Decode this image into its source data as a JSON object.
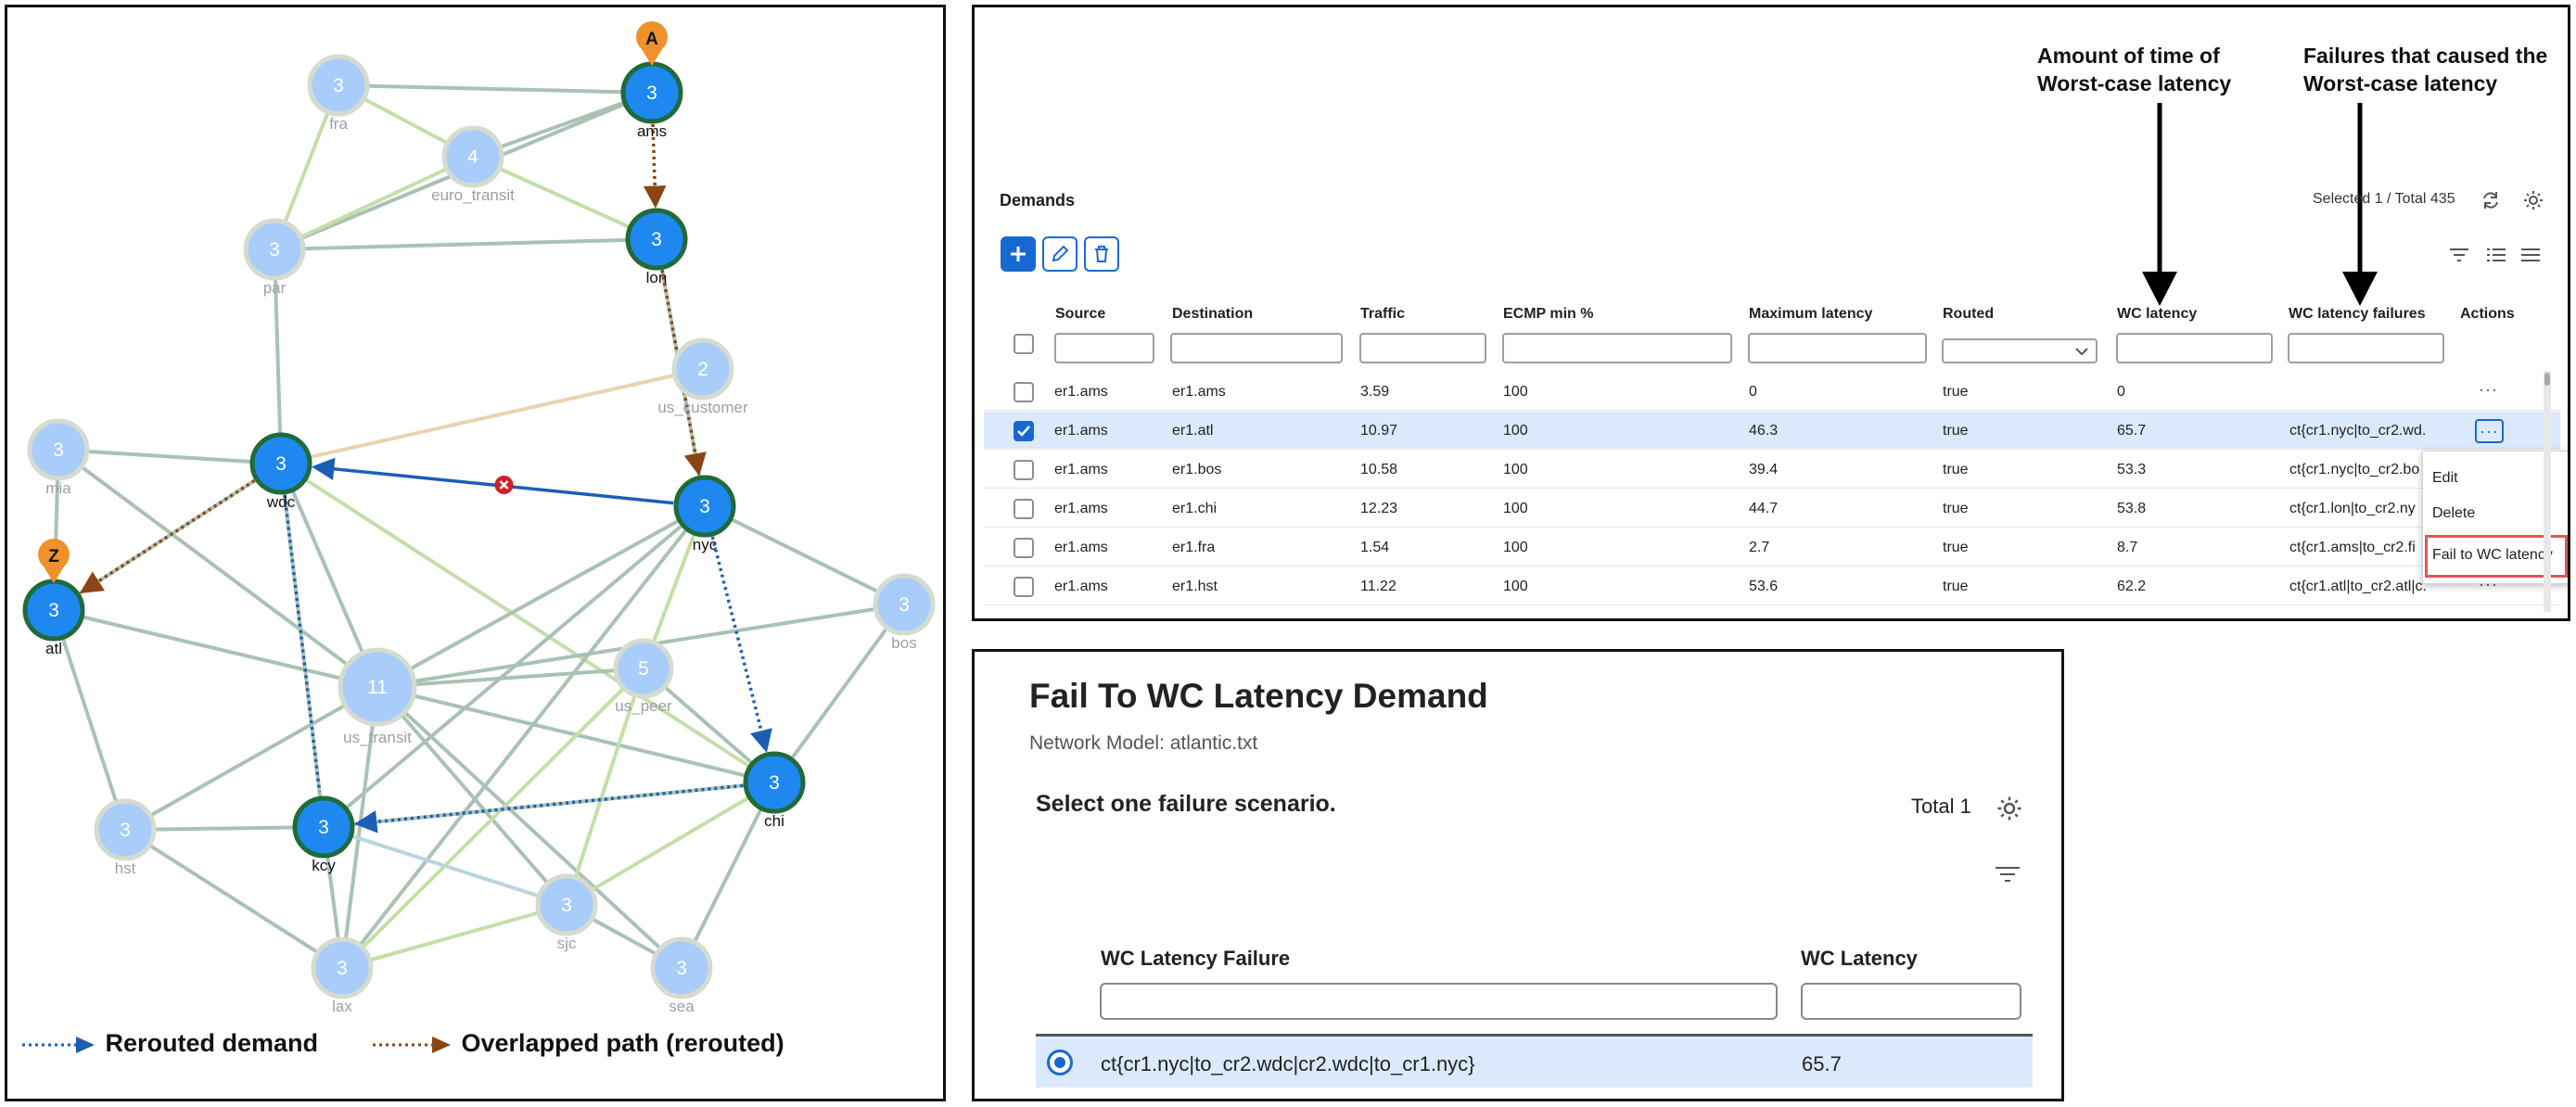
{
  "topology": {
    "nodes": [
      {
        "id": "fra",
        "label": "fra",
        "count": "3",
        "active": false
      },
      {
        "id": "ams",
        "label": "ams",
        "count": "3",
        "active": true,
        "marker": "A"
      },
      {
        "id": "euro_transit",
        "label": "euro_transit",
        "count": "4",
        "active": false
      },
      {
        "id": "par",
        "label": "par",
        "count": "3",
        "active": false
      },
      {
        "id": "lon",
        "label": "lon",
        "count": "3",
        "active": true
      },
      {
        "id": "us_customer",
        "label": "us_customer",
        "count": "2",
        "active": false
      },
      {
        "id": "mia",
        "label": "mia",
        "count": "3",
        "active": false
      },
      {
        "id": "wdc",
        "label": "wdc",
        "count": "3",
        "active": true
      },
      {
        "id": "nyc",
        "label": "nyc",
        "count": "3",
        "active": true
      },
      {
        "id": "atl",
        "label": "atl",
        "count": "3",
        "active": true,
        "marker": "Z"
      },
      {
        "id": "bos",
        "label": "bos",
        "count": "3",
        "active": false
      },
      {
        "id": "us_transit",
        "label": "us_transit",
        "count": "11",
        "active": false
      },
      {
        "id": "us_peer",
        "label": "us_peer",
        "count": "5",
        "active": false
      },
      {
        "id": "chi",
        "label": "chi",
        "count": "3",
        "active": true
      },
      {
        "id": "hst",
        "label": "hst",
        "count": "3",
        "active": false
      },
      {
        "id": "kcy",
        "label": "kcy",
        "count": "3",
        "active": true
      },
      {
        "id": "sjc",
        "label": "sjc",
        "count": "3",
        "active": false
      },
      {
        "id": "lax",
        "label": "lax",
        "count": "3",
        "active": false
      },
      {
        "id": "sea",
        "label": "sea",
        "count": "3",
        "active": false
      }
    ],
    "legend": {
      "rerouted": "Rerouted demand",
      "overlapped": "Overlapped path (rerouted)"
    },
    "colors": {
      "active_node": "#1e88f0",
      "active_ring": "#1f6b3a",
      "inactive_node": "#a9cdfa",
      "rerouted": "#1a5fb4",
      "overlapped": "#8b4513",
      "failed": "#d0202a",
      "marker": "#f0922b"
    }
  },
  "annotations": {
    "wc_latency": "Amount of time of\nWorst-case latency",
    "wc_failures": "Failures that caused the\nWorst-case latency"
  },
  "demands": {
    "title": "Demands",
    "count": "Selected 1 / Total 435",
    "columns": [
      "Source",
      "Destination",
      "Traffic",
      "ECMP min %",
      "Maximum latency",
      "Routed",
      "WC latency",
      "WC latency failures",
      "Actions"
    ],
    "rows": [
      {
        "selected": false,
        "source": "er1.ams",
        "destination": "er1.ams",
        "traffic": "3.59",
        "ecmp": "100",
        "max_latency": "0",
        "routed": "true",
        "wc_latency": "0",
        "wc_failures": ""
      },
      {
        "selected": true,
        "source": "er1.ams",
        "destination": "er1.atl",
        "traffic": "10.97",
        "ecmp": "100",
        "max_latency": "46.3",
        "routed": "true",
        "wc_latency": "65.7",
        "wc_failures": "ct{cr1.nyc|to_cr2.wd..."
      },
      {
        "selected": false,
        "source": "er1.ams",
        "destination": "er1.bos",
        "traffic": "10.58",
        "ecmp": "100",
        "max_latency": "39.4",
        "routed": "true",
        "wc_latency": "53.3",
        "wc_failures": "ct{cr1.nyc|to_cr2.bo"
      },
      {
        "selected": false,
        "source": "er1.ams",
        "destination": "er1.chi",
        "traffic": "12.23",
        "ecmp": "100",
        "max_latency": "44.7",
        "routed": "true",
        "wc_latency": "53.8",
        "wc_failures": "ct{cr1.lon|to_cr2.ny"
      },
      {
        "selected": false,
        "source": "er1.ams",
        "destination": "er1.fra",
        "traffic": "1.54",
        "ecmp": "100",
        "max_latency": "2.7",
        "routed": "true",
        "wc_latency": "8.7",
        "wc_failures": "ct{cr1.ams|to_cr2.fi"
      },
      {
        "selected": false,
        "source": "er1.ams",
        "destination": "er1.hst",
        "traffic": "11.22",
        "ecmp": "100",
        "max_latency": "53.6",
        "routed": "true",
        "wc_latency": "62.2",
        "wc_failures": "ct{cr1.atl|to_cr2.atl|c..."
      }
    ],
    "more": "···",
    "menu": [
      "Edit",
      "Delete",
      "Fail to WC latency"
    ]
  },
  "fail_dialog": {
    "title": "Fail To WC Latency Demand",
    "subtitle": "Network Model: atlantic.txt",
    "instruction": "Select one failure scenario.",
    "total": "Total 1",
    "col_failure": "WC Latency Failure",
    "col_latency": "WC Latency",
    "row_failure": "ct{cr1.nyc|to_cr2.wdc|cr2.wdc|to_cr1.nyc}",
    "row_latency": "65.7"
  }
}
